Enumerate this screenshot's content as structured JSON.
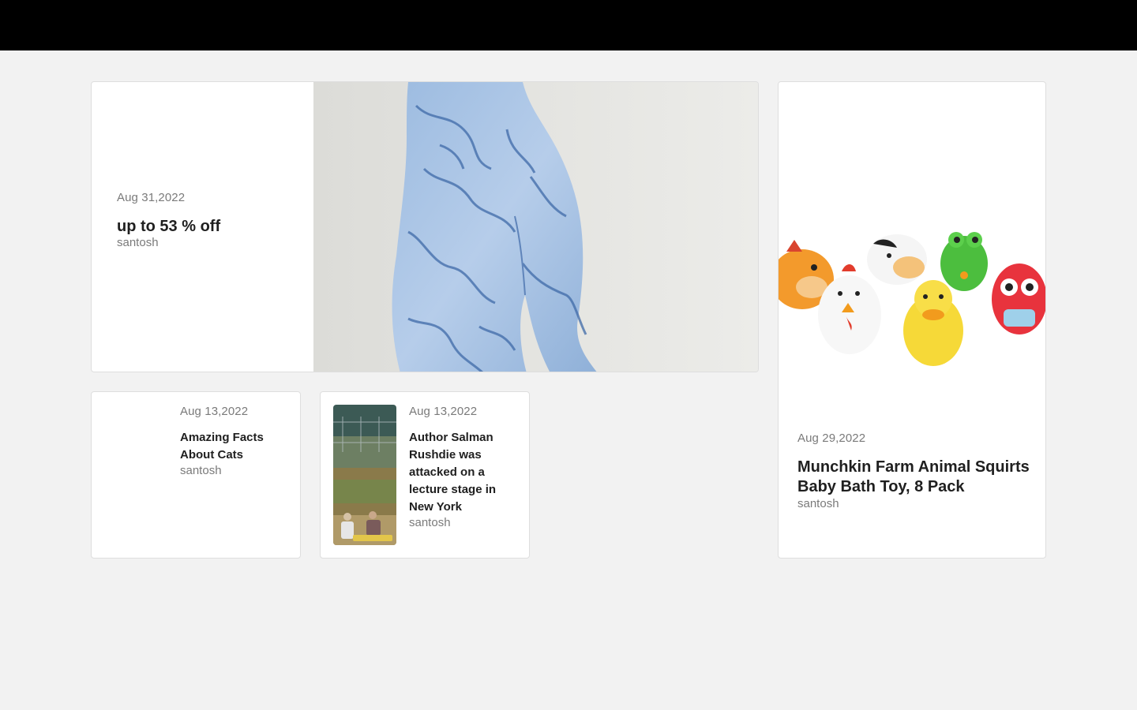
{
  "posts": [
    {
      "date": "Aug 31,2022",
      "title": "up to 53 % off",
      "author": "santosh",
      "image": "tie-dye-leggings-photo"
    },
    {
      "date": "Aug 13,2022",
      "title": "Amazing Facts About Cats",
      "author": "santosh"
    },
    {
      "date": "Aug 13,2022",
      "title": "Author Salman Rushdie was attacked on a lecture stage in New York",
      "author": "santosh",
      "image": "field-photo"
    },
    {
      "date": "Aug 29,2022",
      "title": "Munchkin Farm Animal Squirts Baby Bath Toy, 8 Pack",
      "author": "santosh",
      "image": "bath-toys-photo"
    }
  ],
  "colors": {
    "background": "#f2f2f2",
    "topbar": "#000000",
    "card": "#ffffff",
    "meta_text": "#7a7a7a",
    "title_text": "#1f1f1f"
  }
}
